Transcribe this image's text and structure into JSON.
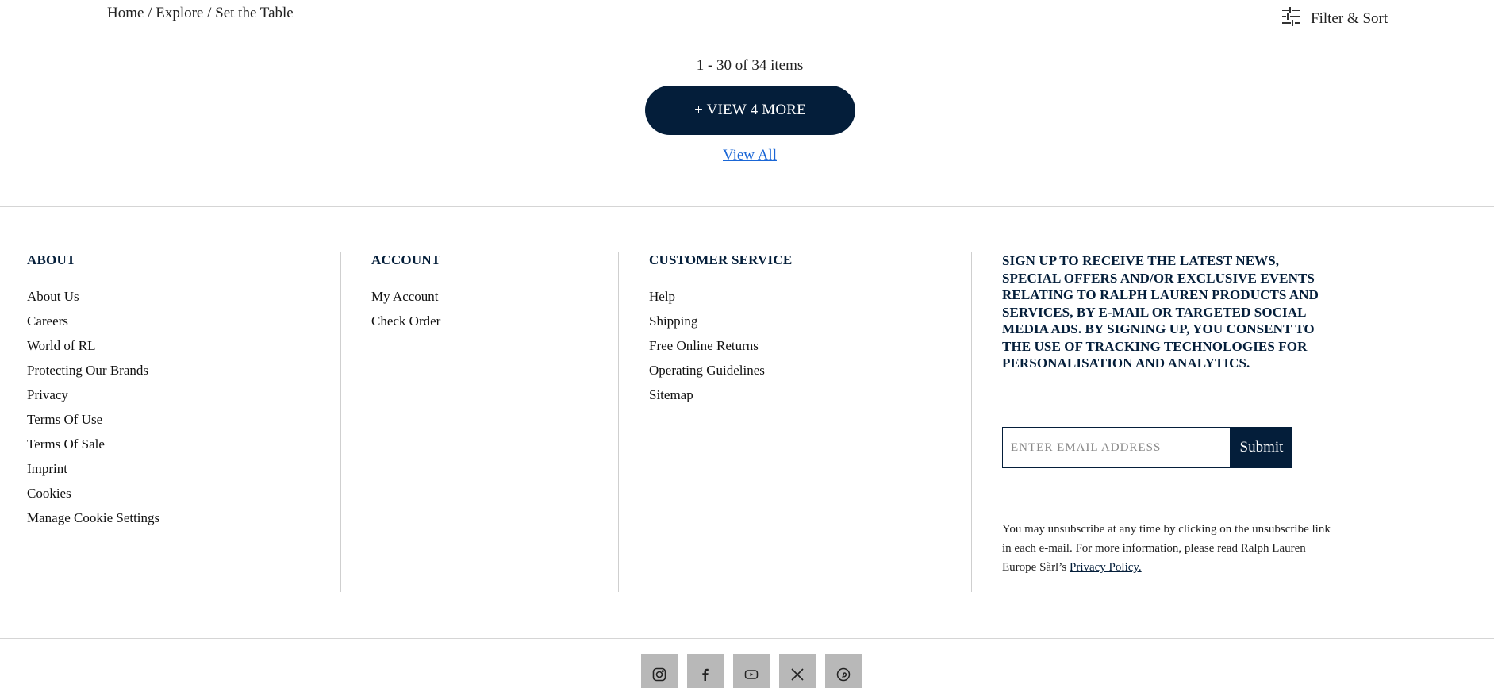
{
  "breadcrumb": {
    "home": "Home",
    "sep1": " / ",
    "explore": "Explore",
    "sep2": " / ",
    "current": "Set the Table"
  },
  "filter_sort": {
    "label": "Filter & Sort",
    "icon": "sliders-icon"
  },
  "pagination": {
    "count_text": "1 - 30 of 34 items",
    "view_more_label": "+ VIEW 4 MORE",
    "view_all_label": "View All"
  },
  "footer": {
    "about": {
      "heading": "ABOUT",
      "items": [
        "About Us",
        "Careers",
        "World of RL",
        "Protecting Our Brands",
        "Privacy",
        "Terms Of Use",
        "Terms Of Sale",
        "Imprint",
        "Cookies",
        "Manage Cookie Settings"
      ]
    },
    "account": {
      "heading": "ACCOUNT",
      "items": [
        "My Account",
        "Check Order"
      ]
    },
    "customer_service": {
      "heading": "CUSTOMER SERVICE",
      "items": [
        "Help",
        "Shipping",
        "Free Online Returns",
        "Operating Guidelines",
        "Sitemap"
      ]
    },
    "signup": {
      "heading": "SIGN UP TO RECEIVE THE LATEST NEWS, SPECIAL OFFERS AND/OR EXCLUSIVE EVENTS RELATING TO RALPH LAUREN PRODUCTS AND SERVICES, BY E-MAIL OR TARGETED SOCIAL MEDIA ADS. BY SIGNING UP, YOU CONSENT TO THE USE OF TRACKING TECHNOLOGIES FOR PERSONALISATION AND ANALYTICS.",
      "email_placeholder": "ENTER EMAIL ADDRESS",
      "email_value": "",
      "submit_label": "Submit",
      "legal_text": "You may unsubscribe at any time by clicking on the unsubscribe link in each e-mail. For more information, please read Ralph Lauren Europe Sàrl’s ",
      "privacy_link": "Privacy Policy."
    },
    "social": [
      "instagram-icon",
      "facebook-icon",
      "youtube-icon",
      "x-twitter-icon",
      "pinterest-icon"
    ]
  },
  "colors": {
    "navy": "#041e3a",
    "link_blue": "#1a66d6",
    "social_bg": "#b8b8b8"
  }
}
